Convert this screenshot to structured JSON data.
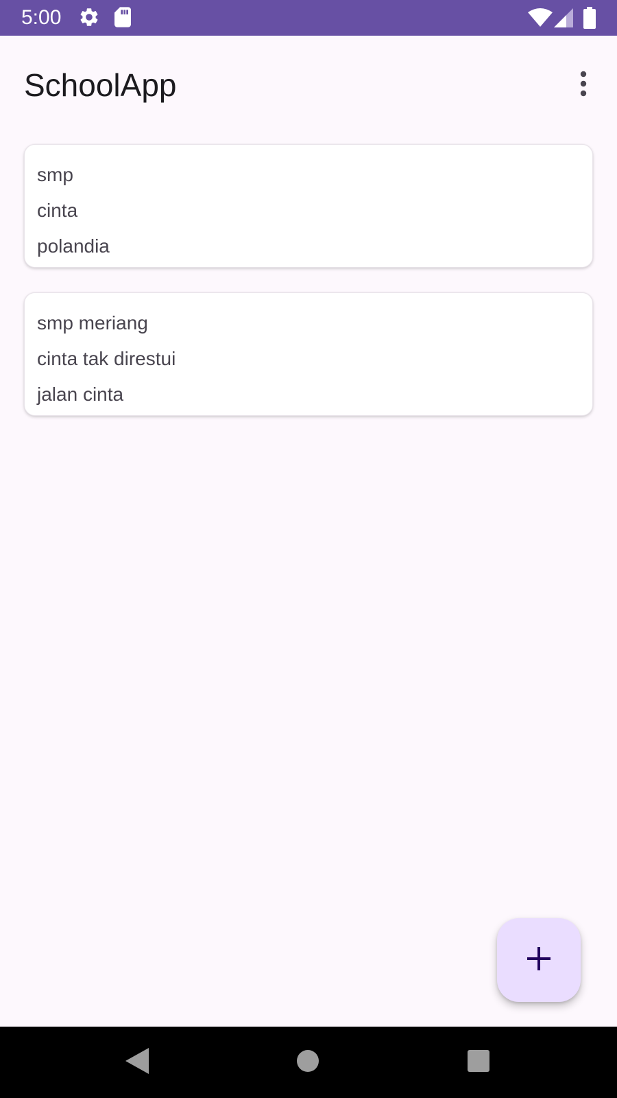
{
  "status_bar": {
    "time": "5:00",
    "color": "#6750a4",
    "left_icons": [
      "gear-icon",
      "sd-card-icon"
    ],
    "right_icons": [
      "wifi-icon",
      "cell-signal-icon",
      "battery-icon"
    ]
  },
  "app_bar": {
    "title": "SchoolApp",
    "overflow_icon": "more-vert-icon"
  },
  "notes": [
    {
      "lines": [
        "smp",
        "cinta",
        "polandia"
      ]
    },
    {
      "lines": [
        "smp meriang",
        "cinta tak direstui",
        "jalan cinta"
      ]
    }
  ],
  "fab": {
    "icon": "plus-icon",
    "background": "#eaddff",
    "icon_color": "#21005d"
  },
  "nav_bar": {
    "icons": [
      "back-icon",
      "home-icon",
      "recents-icon"
    ]
  }
}
